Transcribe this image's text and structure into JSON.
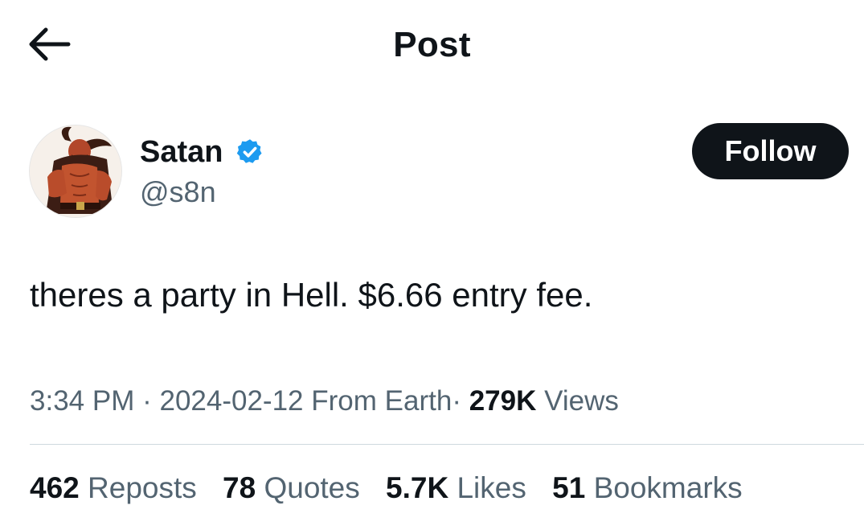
{
  "header": {
    "title": "Post",
    "back_icon": "arrow-left-icon"
  },
  "author": {
    "display_name": "Satan",
    "handle": "@s8n",
    "verified_icon": "verified-badge-icon",
    "verified_color": "#1d9bf0",
    "follow_label": "Follow"
  },
  "post": {
    "text": "theres a party in Hell. $6.66 entry fee."
  },
  "meta": {
    "time": "3:34 PM",
    "separator": "·",
    "date": "2024-02-12",
    "location": "From Earth",
    "views_count": "279K",
    "views_label": "Views"
  },
  "stats": {
    "reposts_count": "462",
    "reposts_label": "Reposts",
    "quotes_count": "78",
    "quotes_label": "Quotes",
    "likes_count": "5.7K",
    "likes_label": "Likes",
    "bookmarks_count": "51",
    "bookmarks_label": "Bookmarks"
  },
  "colors": {
    "text_primary": "#0f1419",
    "text_secondary": "#536471",
    "divider": "#cfd9de",
    "follow_bg": "#0f1419"
  }
}
